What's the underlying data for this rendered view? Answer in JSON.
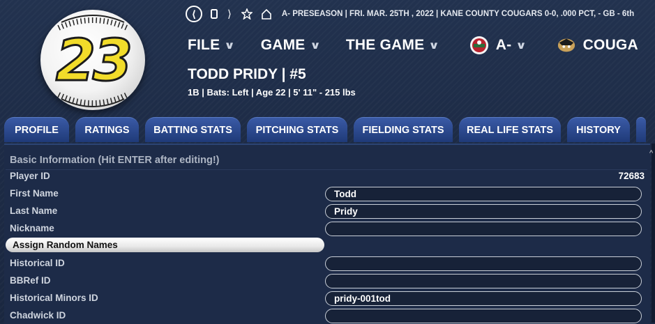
{
  "ball": {
    "number": "23"
  },
  "topbar": {
    "status": "A- PRESEASON  |  FRI. MAR. 25TH , 2022  |  KANE COUNTY COUGARS   0-0, .000 PCT, - GB - 6th"
  },
  "menu": {
    "file": "FILE",
    "game": "GAME",
    "the_game": "THE GAME",
    "league": "A-",
    "team": "COUGA"
  },
  "player": {
    "name": "TODD PRIDY  |  #5",
    "info": "1B | Bats: Left  |  Age 22  |  5' 11\" - 215 lbs"
  },
  "tabs": [
    "PROFILE",
    "RATINGS",
    "BATTING STATS",
    "PITCHING STATS",
    "FIELDING STATS",
    "REAL LIFE STATS",
    "HISTORY"
  ],
  "section": {
    "title": "Basic Information (Hit ENTER after editing!)",
    "player_id_label": "Player ID",
    "player_id_value": "72683",
    "first_name_label": "First Name",
    "first_name_value": "Todd",
    "last_name_label": "Last Name",
    "last_name_value": "Pridy",
    "nickname_label": "Nickname",
    "nickname_value": "",
    "assign_button": "Assign Random Names",
    "historical_id_label": "Historical ID",
    "historical_id_value": "",
    "bbref_id_label": "BBRef ID",
    "bbref_id_value": "",
    "historical_minors_id_label": "Historical Minors ID",
    "historical_minors_id_value": "pridy-001tod",
    "chadwick_id_label": "Chadwick ID",
    "chadwick_id_value": ""
  },
  "colors": {
    "tab_blue": "#2b4a92",
    "background": "#1c2a44",
    "ball_number": "#f2dc2a"
  },
  "icons": [
    "back-circle-icon",
    "page-icon",
    "forward-arrow-icon",
    "star-icon",
    "home-icon",
    "league-logo-icon",
    "team-logo-icon",
    "chevron-down-icon",
    "scroll-up-icon"
  ]
}
